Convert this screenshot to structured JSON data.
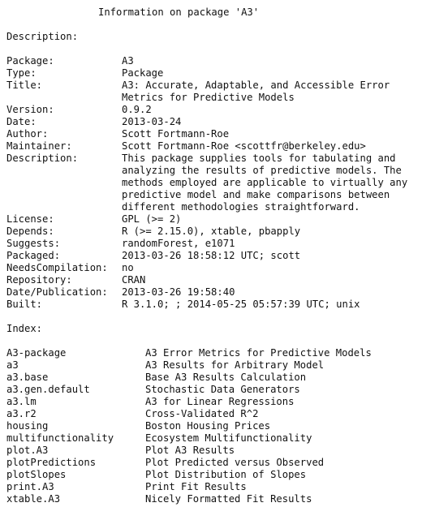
{
  "header": {
    "title": "Information on package 'A3'"
  },
  "sections": {
    "description_heading": "Description:",
    "index_heading": "Index:"
  },
  "description": {
    "fields": [
      {
        "key": "Package:",
        "lines": [
          "A3"
        ]
      },
      {
        "key": "Type:",
        "lines": [
          "Package"
        ]
      },
      {
        "key": "Title:",
        "lines": [
          "A3: Accurate, Adaptable, and Accessible Error",
          "Metrics for Predictive Models"
        ]
      },
      {
        "key": "Version:",
        "lines": [
          "0.9.2"
        ]
      },
      {
        "key": "Date:",
        "lines": [
          "2013-03-24"
        ]
      },
      {
        "key": "Author:",
        "lines": [
          "Scott Fortmann-Roe"
        ]
      },
      {
        "key": "Maintainer:",
        "lines": [
          "Scott Fortmann-Roe <scottfr@berkeley.edu>"
        ]
      },
      {
        "key": "Description:",
        "lines": [
          "This package supplies tools for tabulating and",
          "analyzing the results of predictive models. The",
          "methods employed are applicable to virtually any",
          "predictive model and make comparisons between",
          "different methodologies straightforward."
        ]
      },
      {
        "key": "License:",
        "lines": [
          "GPL (>= 2)"
        ]
      },
      {
        "key": "Depends:",
        "lines": [
          "R (>= 2.15.0), xtable, pbapply"
        ]
      },
      {
        "key": "Suggests:",
        "lines": [
          "randomForest, e1071"
        ]
      },
      {
        "key": "Packaged:",
        "lines": [
          "2013-03-26 18:58:12 UTC; scott"
        ]
      },
      {
        "key": "NeedsCompilation:",
        "lines": [
          "no"
        ]
      },
      {
        "key": "Repository:",
        "lines": [
          "CRAN"
        ]
      },
      {
        "key": "Date/Publication:",
        "lines": [
          "2013-03-26 19:58:40"
        ]
      },
      {
        "key": "Built:",
        "lines": [
          "R 3.1.0; ; 2014-05-25 05:57:39 UTC; unix"
        ]
      }
    ]
  },
  "index": {
    "entries": [
      {
        "name": "A3-package",
        "desc": "A3 Error Metrics for Predictive Models"
      },
      {
        "name": "a3",
        "desc": "A3 Results for Arbitrary Model"
      },
      {
        "name": "a3.base",
        "desc": "Base A3 Results Calculation"
      },
      {
        "name": "a3.gen.default",
        "desc": "Stochastic Data Generators"
      },
      {
        "name": "a3.lm",
        "desc": "A3 for Linear Regressions"
      },
      {
        "name": "a3.r2",
        "desc": "Cross-Validated R^2"
      },
      {
        "name": "housing",
        "desc": "Boston Housing Prices"
      },
      {
        "name": "multifunctionality",
        "desc": "Ecosystem Multifunctionality"
      },
      {
        "name": "plot.A3",
        "desc": "Plot A3 Results"
      },
      {
        "name": "plotPredictions",
        "desc": "Plot Predicted versus Observed"
      },
      {
        "name": "plotSlopes",
        "desc": "Plot Distribution of Slopes"
      },
      {
        "name": "print.A3",
        "desc": "Print Fit Results"
      },
      {
        "name": "xtable.A3",
        "desc": "Nicely Formatted Fit Results"
      }
    ]
  }
}
